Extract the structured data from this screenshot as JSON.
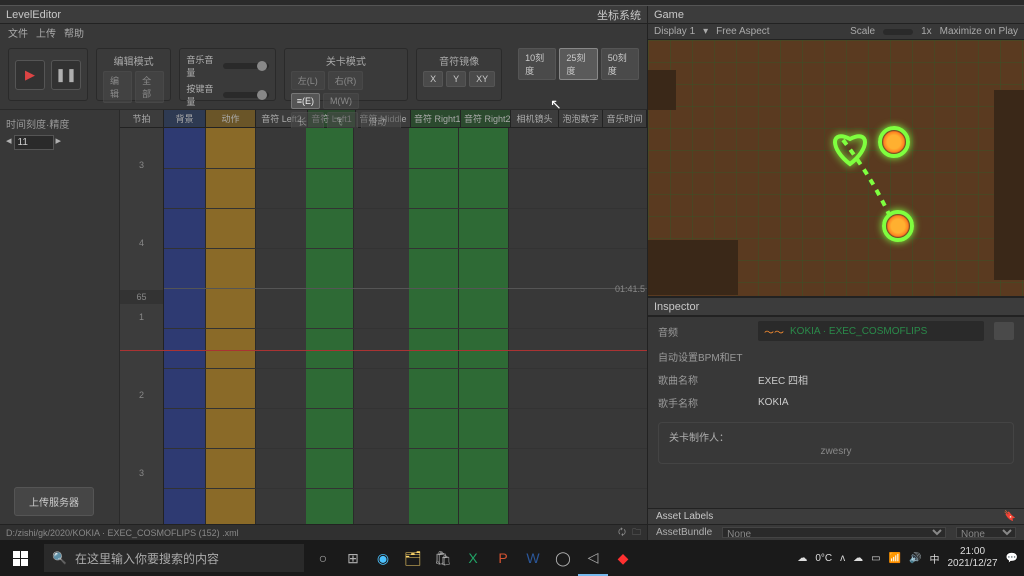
{
  "level_editor": {
    "title": "LevelEditor",
    "menu": [
      "文件",
      "上传",
      "帮助"
    ],
    "right_label": "坐标系统"
  },
  "toolbar": {
    "edit_mode": "编辑模式",
    "edit_sub": [
      "编辑",
      "全部"
    ],
    "music_vol": "音乐音量",
    "key_vol": "按键音量",
    "level_mode": "关卡模式",
    "row1": [
      "左(L)",
      "右(R)"
    ],
    "inv": "≡(E)",
    "row2": [
      "长(Q)",
      "飞(F)",
      "滑动(A)",
      "M(W)"
    ],
    "flip_title": "音符镜像",
    "flip": [
      "X",
      "Y",
      "XY"
    ],
    "scale": [
      "10刻度",
      "25刻度",
      "50刻度"
    ]
  },
  "timeline": {
    "precision": "时间刻度·精度",
    "precision_val": "11",
    "cols": [
      "节拍",
      "背景",
      "动作",
      "音符 Left2",
      "音符 Left1",
      "音符 Middle",
      "音符 Right1",
      "音符 Right2",
      "相机镜头",
      "泡泡数字",
      "音乐时间"
    ],
    "beats": [
      "3",
      "",
      "4",
      "",
      "65",
      "1",
      "",
      "2",
      "",
      "3"
    ],
    "tcode": "01:41.5",
    "upload_btn": "上传服务器",
    "footer_path": "D:/zishi/gk/2020/KOKIA · EXEC_COSMOFLIPS  (152) .xml"
  },
  "game": {
    "title": "Game",
    "display": "Display 1",
    "aspect": "Free Aspect",
    "scale": "Scale",
    "scale_val": "1x",
    "maximize": "Maximize on Play"
  },
  "inspector": {
    "title": "Inspector",
    "audio_lab": "音频",
    "audio_file": "KOKIA · EXEC_COSMOFLIPS",
    "auto_bpm": "自动设置BPM和ET",
    "song_name_lab": "歌曲名称",
    "song_name_val": "EXEC 四相",
    "artist_lab": "歌手名称",
    "artist_val": "KOKIA",
    "credit_lab": "关卡制作人：",
    "credit_val": "zwesry",
    "asset_labels": "Asset Labels",
    "bundle": "AssetBundle",
    "bundle_none": "None"
  },
  "taskbar": {
    "search_placeholder": "在这里输入你要搜索的内容",
    "temp": "0°C",
    "ime": "中",
    "time": "21:00",
    "date": "2021/12/27"
  }
}
